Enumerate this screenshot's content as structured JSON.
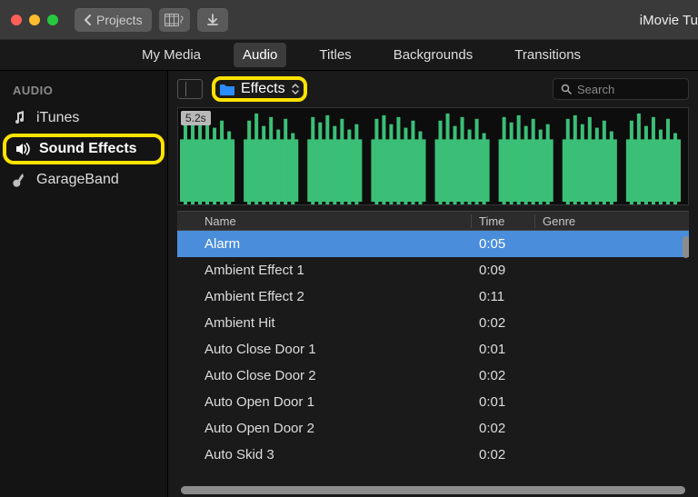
{
  "window": {
    "title": "iMovie Tu"
  },
  "toolbar": {
    "back_label": "Projects"
  },
  "tabs": [
    {
      "label": "My Media",
      "active": false
    },
    {
      "label": "Audio",
      "active": true
    },
    {
      "label": "Titles",
      "active": false
    },
    {
      "label": "Backgrounds",
      "active": false
    },
    {
      "label": "Transitions",
      "active": false
    }
  ],
  "sidebar": {
    "heading": "AUDIO",
    "items": [
      {
        "label": "iTunes",
        "icon": "music-note-icon",
        "selected": false
      },
      {
        "label": "Sound Effects",
        "icon": "speaker-icon",
        "selected": true
      },
      {
        "label": "GarageBand",
        "icon": "guitar-icon",
        "selected": false
      }
    ]
  },
  "library": {
    "dropdown_label": "Effects",
    "search_placeholder": "Search",
    "preview_duration": "5.2s"
  },
  "table": {
    "columns": {
      "name": "Name",
      "time": "Time",
      "genre": "Genre"
    },
    "rows": [
      {
        "name": "Alarm",
        "time": "0:05",
        "genre": "",
        "selected": true
      },
      {
        "name": "Ambient Effect 1",
        "time": "0:09",
        "genre": "",
        "selected": false
      },
      {
        "name": "Ambient Effect 2",
        "time": "0:11",
        "genre": "",
        "selected": false
      },
      {
        "name": "Ambient Hit",
        "time": "0:02",
        "genre": "",
        "selected": false
      },
      {
        "name": "Auto Close Door 1",
        "time": "0:01",
        "genre": "",
        "selected": false
      },
      {
        "name": "Auto Close Door 2",
        "time": "0:02",
        "genre": "",
        "selected": false
      },
      {
        "name": "Auto Open Door 1",
        "time": "0:01",
        "genre": "",
        "selected": false
      },
      {
        "name": "Auto Open Door 2",
        "time": "0:02",
        "genre": "",
        "selected": false
      },
      {
        "name": "Auto Skid 3",
        "time": "0:02",
        "genre": "",
        "selected": false
      }
    ]
  }
}
